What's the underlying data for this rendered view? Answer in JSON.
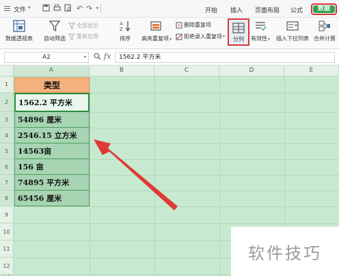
{
  "menubar": {
    "file_label": "文件",
    "tabs": [
      "开始",
      "插入",
      "页面布局",
      "公式"
    ],
    "active_tab": "数据"
  },
  "ribbon": {
    "pivot_label": "数据透视表",
    "autofilter_label": "自动筛选",
    "showall_label": "全部显示",
    "reapply_label": "重新应用",
    "sort_label": "排序",
    "highlight_dup_label": "高亮重复项",
    "delete_dup_label": "删除重复项",
    "reject_dup_label": "拒绝录入重复项",
    "split_label": "分列",
    "validity_label": "有效性",
    "dropdown_label": "插入下拉列表",
    "merge_calc_label": "合并计算"
  },
  "formula_bar": {
    "name_box": "A2",
    "fx_label": "fx",
    "content": "1562.2 平方米"
  },
  "sheet": {
    "columns": [
      "A",
      "B",
      "C",
      "D",
      "E"
    ],
    "rows": [
      "1",
      "2",
      "3",
      "4",
      "5",
      "6",
      "7",
      "8",
      "9",
      "10",
      "11",
      "12",
      "13"
    ],
    "header_cell": "类型",
    "cells": [
      "1562.2 平方米",
      "54896 厘米",
      "2546.15 立方米",
      "14563亩",
      "156 亩",
      "74895 平方米",
      "65456 厘米"
    ]
  },
  "watermark": "软件技巧",
  "colors": {
    "accent": "#2fa44f",
    "highlight_box": "#d9343a",
    "sheet_bg": "#c7e9cf",
    "header_cell": "#f4b17e",
    "arrow": "#e03a36"
  }
}
